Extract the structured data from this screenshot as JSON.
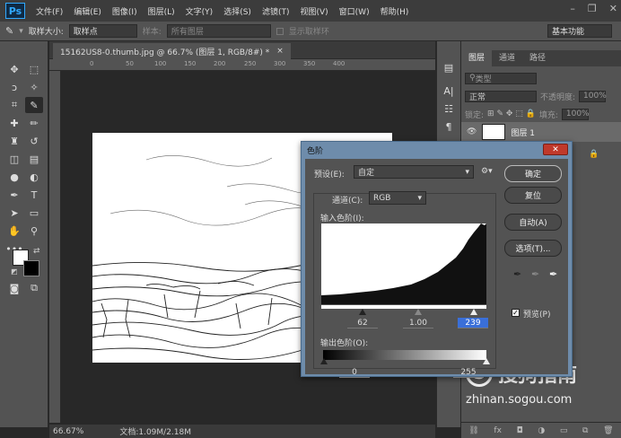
{
  "app": {
    "logo": "Ps"
  },
  "menu": [
    "文件(F)",
    "编辑(E)",
    "图像(I)",
    "图层(L)",
    "文字(Y)",
    "选择(S)",
    "滤镜(T)",
    "视图(V)",
    "窗口(W)",
    "帮助(H)"
  ],
  "options_bar": {
    "sample_size_label": "取样大小:",
    "sample_size_value": "取样点",
    "sample_label": "样本:",
    "sample_value": "所有图层",
    "show_ring_label": "显示取样环",
    "workspace": "基本功能"
  },
  "document": {
    "tab_title": "15162US8-0.thumb.jpg @ 66.7% (图层 1, RGB/8#) *",
    "tab_close": "×",
    "ruler_ticks": [
      "0",
      "50",
      "100",
      "150",
      "200",
      "250",
      "300",
      "350",
      "400"
    ]
  },
  "status": {
    "zoom": "66.67%",
    "doc_info": "文档:1.09M/2.18M"
  },
  "layers_panel": {
    "tabs": [
      "图层",
      "通道",
      "路径"
    ],
    "filter_label": "类型",
    "blend_mode": "正常",
    "opacity_label": "不透明度:",
    "opacity_value": "100%",
    "lock_label": "锁定:",
    "fill_label": "填充:",
    "fill_value": "100%",
    "layer_name": "图层 1"
  },
  "levels_dialog": {
    "title": "色阶",
    "preset_label": "预设(E):",
    "preset_value": "自定",
    "channel_label": "通道(C):",
    "channel_value": "RGB",
    "input_levels_label": "输入色阶(I):",
    "input_black": "62",
    "input_gamma": "1.00",
    "input_white": "239",
    "output_levels_label": "输出色阶(O):",
    "output_black": "0",
    "output_white": "255",
    "buttons": {
      "ok": "确定",
      "reset": "复位",
      "auto": "自动(A)",
      "options": "选项(T)..."
    },
    "preview_label": "预览(P)",
    "preview_checked": true
  },
  "watermark": {
    "brand": "搜狗指南",
    "url": "zhinan.sogou.com"
  }
}
